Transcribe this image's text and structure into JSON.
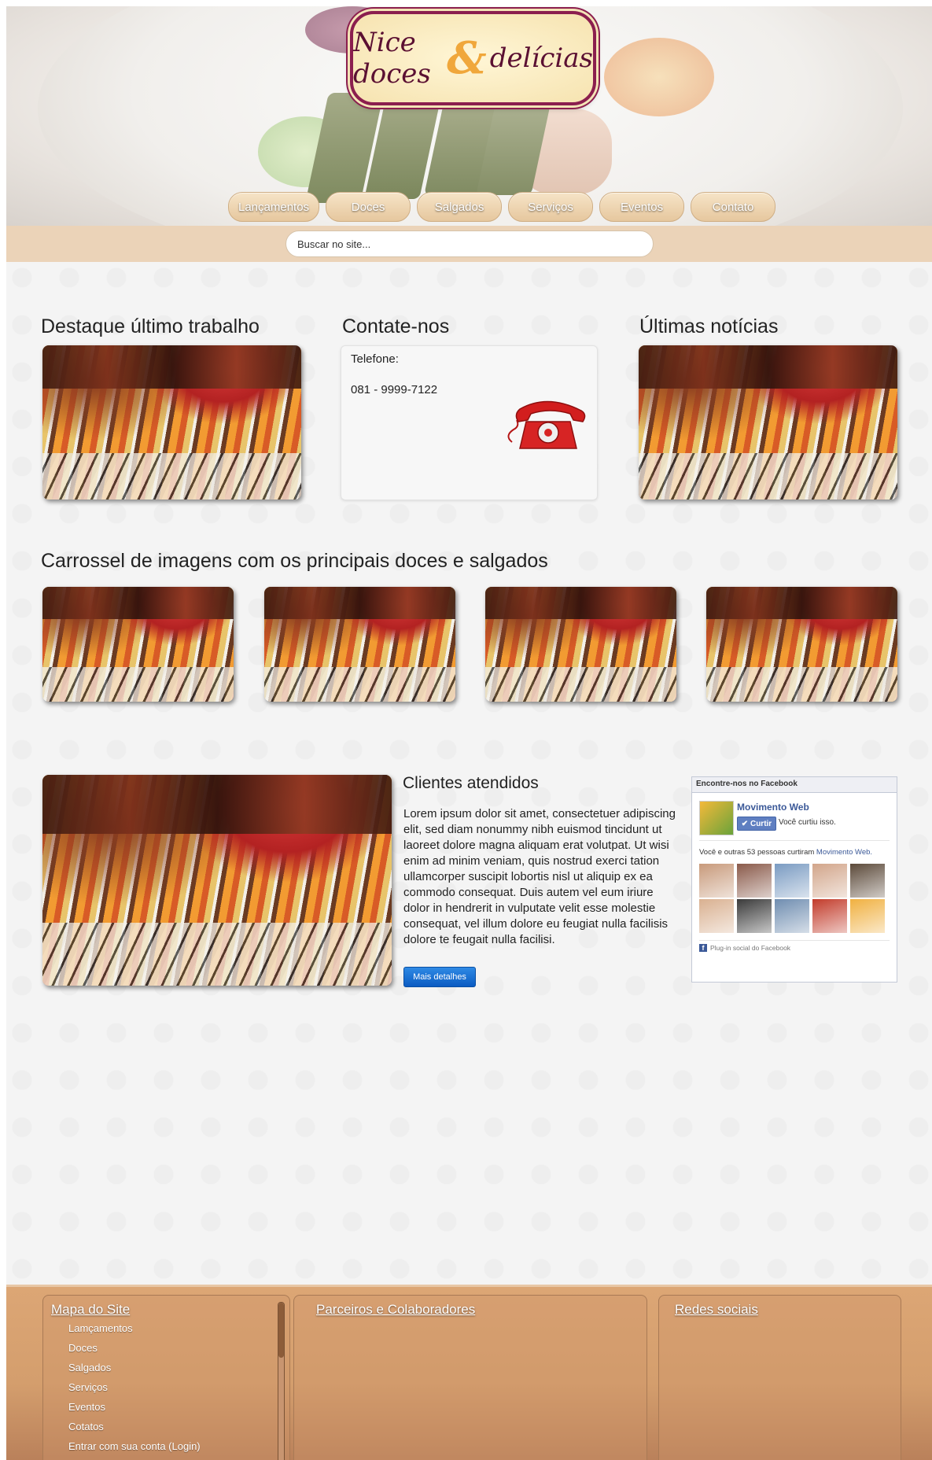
{
  "header": {
    "logo": {
      "word1": "Nice doces",
      "amp": "&",
      "word2": "delícias"
    },
    "nav": [
      "Lançamentos",
      "Doces",
      "Salgados",
      "Serviços",
      "Eventos",
      "Contato"
    ],
    "search": {
      "value": "Buscar no site..."
    }
  },
  "sections": {
    "featured": {
      "title": "Destaque último trabalho"
    },
    "contact": {
      "title": "Contate-nos",
      "label": "Telefone:",
      "phone": "081 - 9999-7122"
    },
    "news": {
      "title": "Últimas notícias"
    },
    "carousel": {
      "title": "Carrossel de imagens com os principais doces e salgados"
    },
    "clients": {
      "title": "Clientes atendidos",
      "body": "Lorem ipsum dolor sit amet, consectetuer adipiscing elit, sed diam nonummy nibh euismod tincidunt ut laoreet dolore magna aliquam erat volutpat. Ut wisi enim ad minim veniam, quis nostrud exerci tation ullamcorper suscipit lobortis nisl ut aliquip ex ea commodo consequat. Duis autem vel eum iriure dolor in hendrerit in vulputate velit esse molestie consequat, vel illum dolore eu feugiat nulla facilisis dolore te feugait nulla facilisi.",
      "button": "Mais detalhes"
    }
  },
  "facebook": {
    "header": "Encontre-nos no Facebook",
    "page_name": "Movimento Web",
    "like_button": "Curtir",
    "liked_text": "Você curtiu isso.",
    "count_prefix": "Você e outras 53 pessoas curtiram",
    "count_link": "Movimento Web.",
    "plugin": "Plug-in social do Facebook",
    "faces": [
      "#c89a7b",
      "#8a5a4a",
      "#7a9bc2",
      "#d2a58a",
      "#5c4a3a",
      "#d9b090",
      "#3a3a3a",
      "#6f8db0",
      "#c23b2a",
      "#f0b040"
    ]
  },
  "footer": {
    "sitemap": {
      "title": "Mapa do Site",
      "items": [
        "Lamçamentos",
        "Doces",
        "Salgados",
        "Serviços",
        "Eventos",
        "Cotatos",
        "Entrar com sua conta (Login)"
      ]
    },
    "partners": {
      "title": "Parceiros e Colaboradores"
    },
    "social": {
      "title": "Redes sociais"
    }
  },
  "colors": {
    "accent_tan": "#ebd3b8",
    "footer_brown": "#d49e6d",
    "logo_wine": "#8b1e4e",
    "fb_blue": "#3b5998"
  }
}
